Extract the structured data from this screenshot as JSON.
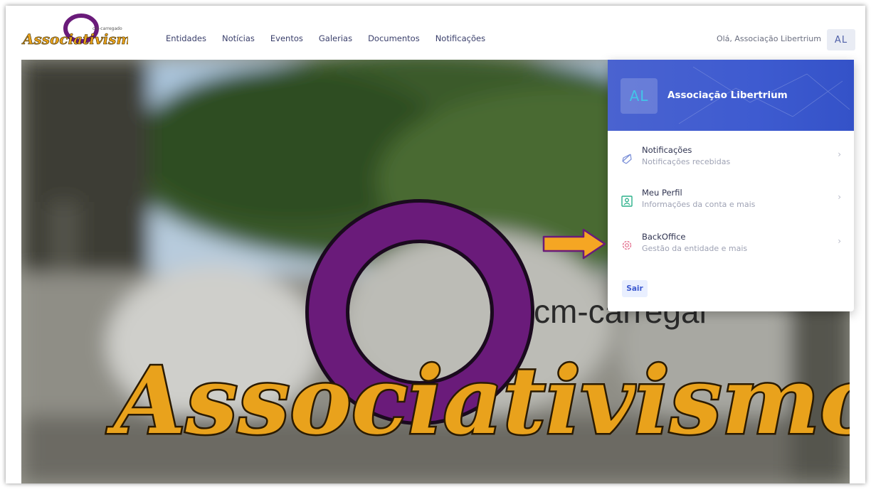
{
  "logo": {
    "text": "Associativismo",
    "tagline": "cm-carregado"
  },
  "nav": {
    "items": [
      "Entidades",
      "Notícias",
      "Eventos",
      "Galerias",
      "Documentos",
      "Notificações"
    ]
  },
  "user": {
    "greeting": "Olá, Associação Libertrium",
    "initials": "AL"
  },
  "hero": {
    "title": "Associativismo",
    "tagline": "cm-carregal"
  },
  "dropdown": {
    "initials": "AL",
    "name": "Associação Libertrium",
    "items": [
      {
        "title": "Notificações",
        "subtitle": "Notificações recebidas",
        "icon": "bell-icon"
      },
      {
        "title": "Meu Perfil",
        "subtitle": "Informações da conta e mais",
        "icon": "profile-icon"
      },
      {
        "title": "BackOffice",
        "subtitle": "Gestão da entidade e mais",
        "icon": "gear-icon"
      }
    ],
    "logout": "Sair"
  },
  "colors": {
    "accent": "#3e5bd0",
    "logo_yellow": "#e9a21c",
    "logo_purple": "#6a1b7a",
    "arrow": "#f5a623"
  }
}
